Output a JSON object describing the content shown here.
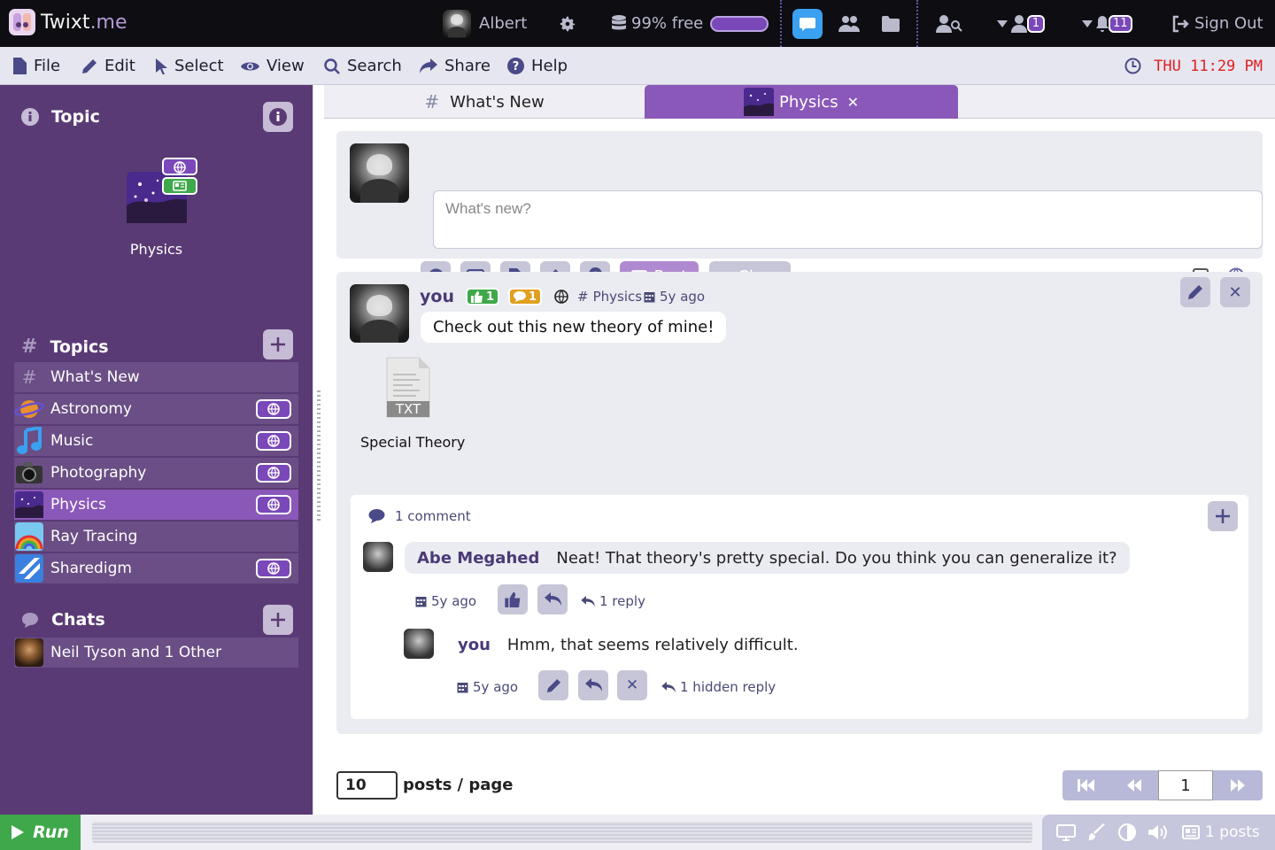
{
  "app": {
    "name_main": "Twixt",
    "name_suffix": ".me"
  },
  "topbar": {
    "user_name": "Albert",
    "storage_text": "99% free",
    "storage_level": 0.99,
    "friend_requests_count": "1",
    "notifications_count": "11",
    "sign_out_label": "Sign Out"
  },
  "menu": {
    "file": "File",
    "edit": "Edit",
    "select": "Select",
    "view": "View",
    "search": "Search",
    "share": "Share",
    "help": "Help",
    "clock": "THU 11:29 PM"
  },
  "sidebar": {
    "topic_heading": "Topic",
    "current_topic": "Physics",
    "topics_heading": "Topics",
    "topics": [
      {
        "label": "What's New",
        "icon": "hash-icon",
        "public": false
      },
      {
        "label": "Astronomy",
        "icon": "planet-icon",
        "public": true
      },
      {
        "label": "Music",
        "icon": "music-note-icon",
        "public": true
      },
      {
        "label": "Photography",
        "icon": "camera-icon",
        "public": true
      },
      {
        "label": "Physics",
        "icon": "galaxy-icon",
        "public": true,
        "selected": true
      },
      {
        "label": "Ray Tracing",
        "icon": "rainbow-icon",
        "public": false
      },
      {
        "label": "Sharedigm",
        "icon": "sharedigm-icon",
        "public": true
      }
    ],
    "chats_heading": "Chats",
    "chats": [
      {
        "label": "Neil Tyson and 1 Other"
      }
    ]
  },
  "tabs": [
    {
      "label": "What's New",
      "active": false
    },
    {
      "label": "Physics",
      "active": true
    }
  ],
  "compose": {
    "placeholder": "What's new?",
    "post_label": "Post",
    "clear_label": "Clear"
  },
  "post": {
    "author": "you",
    "likes": "1",
    "comments_count": "1",
    "topic": "Physics",
    "age": "5y ago",
    "text": "Check out this new theory of mine!",
    "attachment": {
      "type_label": "TXT",
      "name": "Special Theory"
    }
  },
  "comments": {
    "header": "1 comment",
    "items": [
      {
        "author": "Abe Megahed",
        "text": "Neat! That theory's pretty special. Do you think you can generalize it?",
        "age": "5y ago",
        "replies_label": "1 reply"
      }
    ],
    "reply": {
      "author": "you",
      "text": "Hmm, that seems relatively difficult.",
      "age": "5y ago",
      "hidden_label": "1 hidden reply"
    }
  },
  "pagination": {
    "per_page": "10",
    "per_page_label": "posts / page",
    "current_page": "1"
  },
  "bottom": {
    "run_label": "Run",
    "posts_label": "1 posts"
  },
  "colors": {
    "accent": "#8a58b8",
    "sidebar": "#5a3a74",
    "run": "#3fa84a",
    "clock": "#e02020"
  }
}
